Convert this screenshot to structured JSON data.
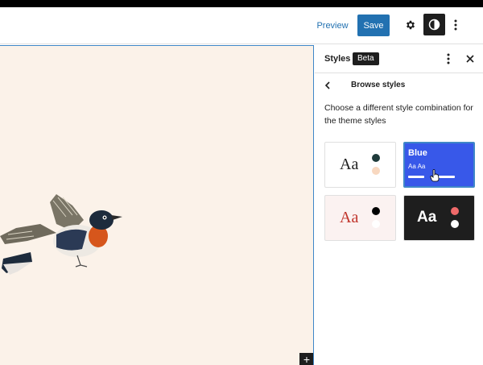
{
  "header": {
    "preview_label": "Preview",
    "save_label": "Save",
    "icons": [
      "gear-icon",
      "half-circle-icon",
      "vertical-ellipsis-icon"
    ]
  },
  "canvas": {
    "background": "#fbf2e9",
    "add_block_label": "+"
  },
  "sidebar": {
    "title": "Styles",
    "badge": "Beta",
    "nav_title": "Browse styles",
    "description": "Choose a different style combination for the theme styles",
    "variations": [
      {
        "id": "default",
        "aa": "Aa",
        "colors": [
          "#1f3b3b",
          "#f8d8c0"
        ]
      },
      {
        "id": "blue",
        "title": "Blue",
        "subtitle": "Aa Aa",
        "colors": [
          "#3858e9",
          "#ffffff"
        ]
      },
      {
        "id": "red",
        "aa": "Aa",
        "colors": [
          "#000000",
          "#ffffff",
          "#c0342b"
        ]
      },
      {
        "id": "dark",
        "aa": "Aa",
        "colors": [
          "#f06a6a",
          "#ffffff",
          "#1e1e1e"
        ]
      }
    ]
  },
  "colors": {
    "accent": "#2271b1",
    "focus_border": "#3f87c8",
    "dark": "#1e1e1e"
  }
}
